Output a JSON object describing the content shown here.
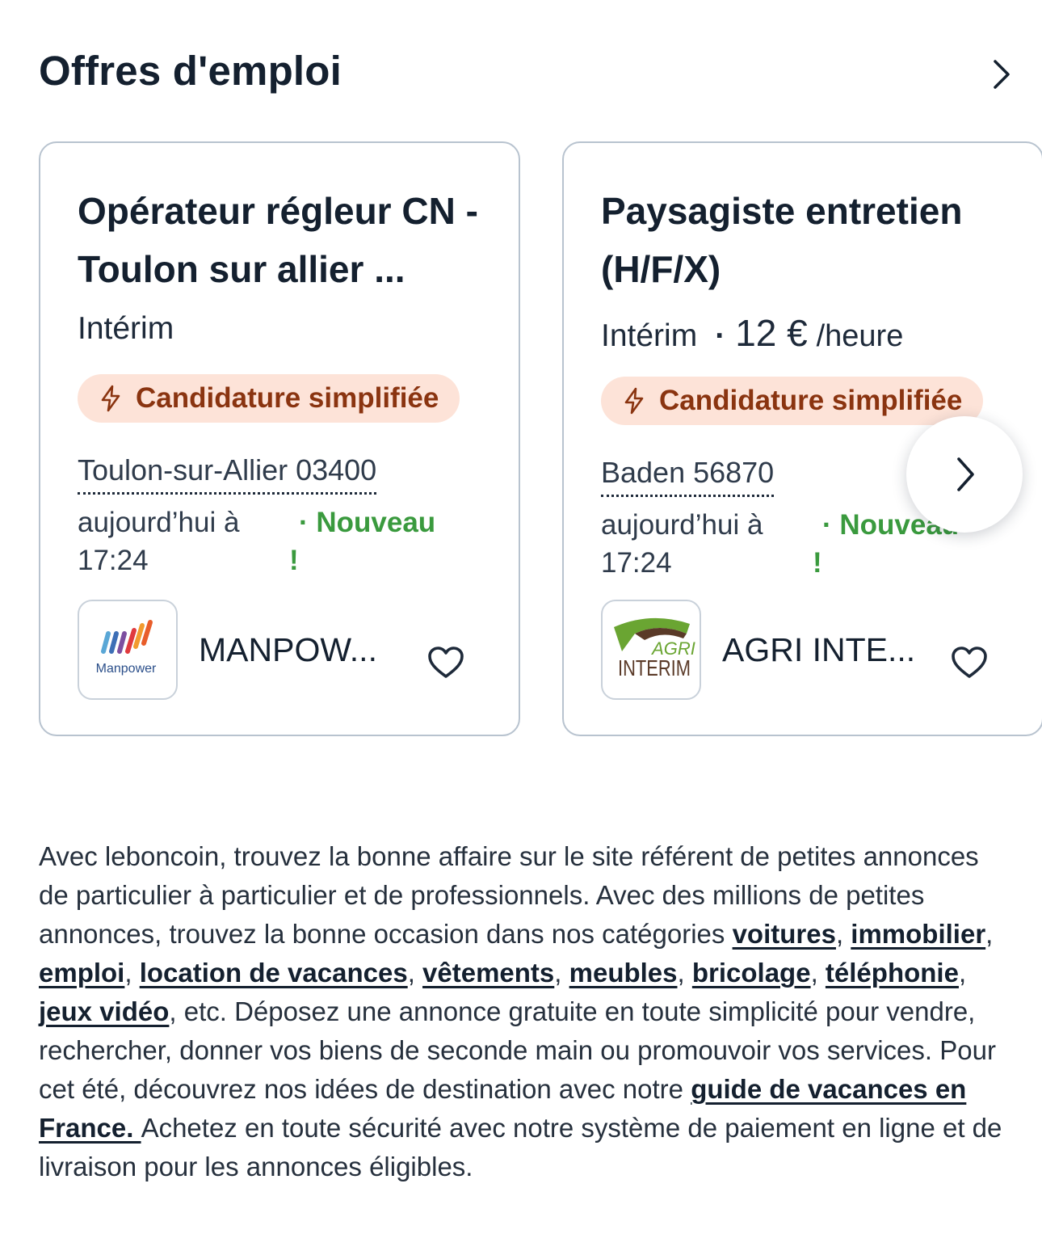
{
  "section": {
    "title": "Offres d'emploi"
  },
  "cards": [
    {
      "title": "Opérateur régleur CN - Toulon sur allier ...",
      "contract": "Intérim",
      "badge": "Candidature simplifiée",
      "location": "Toulon-sur-Allier 03400",
      "date": "aujourd’hui à 17:24",
      "new_label": "· Nouveau",
      "new_excl": "!",
      "company": "MANPOW...",
      "logo_text": "Manpower"
    },
    {
      "title": "Paysagiste entretien (H/F/X)",
      "contract": "Intérim",
      "dot": "·",
      "price": "12 €",
      "unit": "/heure",
      "badge": "Candidature simplifiée",
      "location": "Baden 56870",
      "date": "aujourd’hui à 17:24",
      "new_label": "· Nouveau",
      "new_excl": "!",
      "company": "AGRI INTE...",
      "logo_text_1": "AGRI",
      "logo_text_2": "INTERIM"
    }
  ],
  "seo": {
    "p1": "Avec leboncoin, trouvez la bonne affaire sur le site référent de petites annonces de particulier à particulier et de professionnels. Avec des millions de petites annonces, trouvez la bonne occasion dans nos catégories ",
    "links": [
      "voitures",
      "immobilier",
      "emploi",
      "location de vacances",
      "vêtements",
      "meubles",
      "bricolage",
      "téléphonie",
      "jeux vidéo"
    ],
    "sep": ", ",
    "p2": ", etc. Déposez une annonce gratuite en toute simplicité pour vendre, rechercher, donner vos biens de seconde main ou promouvoir vos services. Pour cet été, découvrez nos idées de destination avec notre ",
    "guide_link": "guide de vacances en France. ",
    "p3": " Achetez en toute sécurité avec notre système de paiement en ligne et de livraison pour les annonces éligibles."
  },
  "colors": {
    "badge_bg": "#fde3d8",
    "badge_text": "#8a3410",
    "new": "#3a9a3e",
    "border": "#b8c3cf",
    "text": "#14202f"
  }
}
